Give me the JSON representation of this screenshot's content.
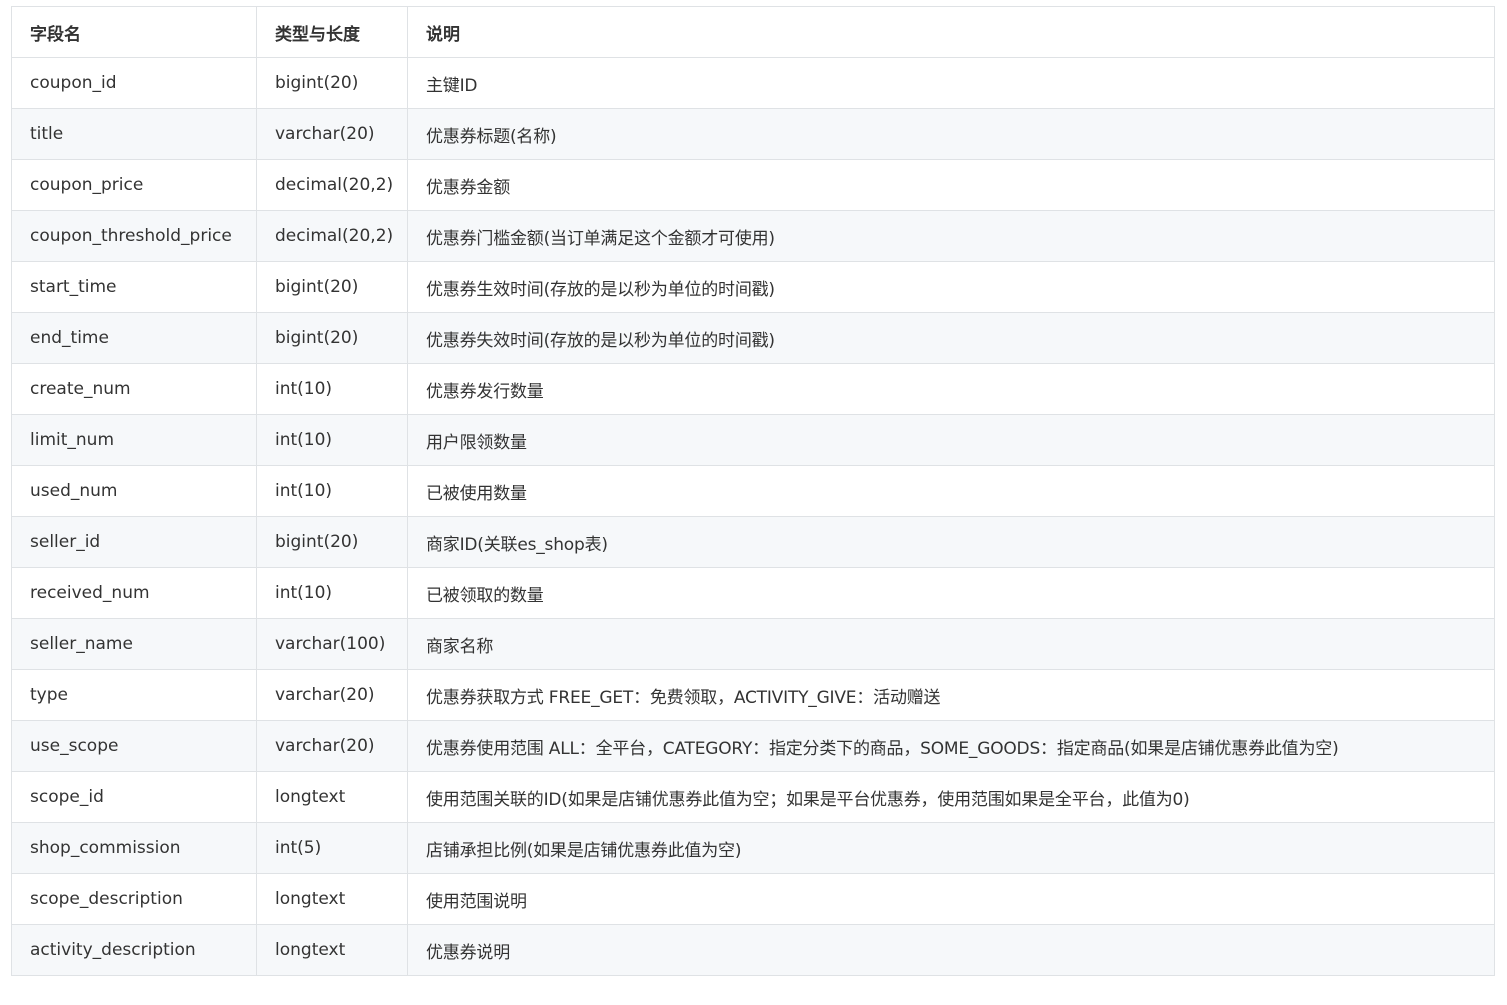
{
  "table": {
    "headers": [
      "字段名",
      "类型与长度",
      "说明"
    ],
    "rows": [
      [
        "coupon_id",
        "bigint(20)",
        "主键ID"
      ],
      [
        "title",
        "varchar(20)",
        "优惠券标题(名称)"
      ],
      [
        "coupon_price",
        "decimal(20,2)",
        "优惠券金额"
      ],
      [
        "coupon_threshold_price",
        "decimal(20,2)",
        "优惠券门槛金额(当订单满足这个金额才可使用)"
      ],
      [
        "start_time",
        "bigint(20)",
        "优惠券生效时间(存放的是以秒为单位的时间戳)"
      ],
      [
        "end_time",
        "bigint(20)",
        "优惠券失效时间(存放的是以秒为单位的时间戳)"
      ],
      [
        "create_num",
        "int(10)",
        "优惠券发行数量"
      ],
      [
        "limit_num",
        "int(10)",
        "用户限领数量"
      ],
      [
        "used_num",
        "int(10)",
        "已被使用数量"
      ],
      [
        "seller_id",
        "bigint(20)",
        "商家ID(关联es_shop表)"
      ],
      [
        "received_num",
        "int(10)",
        "已被领取的数量"
      ],
      [
        "seller_name",
        "varchar(100)",
        "商家名称"
      ],
      [
        "type",
        "varchar(20)",
        "优惠券获取方式 FREE_GET：免费领取，ACTIVITY_GIVE：活动赠送"
      ],
      [
        "use_scope",
        "varchar(20)",
        "优惠券使用范围 ALL：全平台，CATEGORY：指定分类下的商品，SOME_GOODS：指定商品(如果是店铺优惠券此值为空)"
      ],
      [
        "scope_id",
        "longtext",
        "使用范围关联的ID(如果是店铺优惠券此值为空；如果是平台优惠券，使用范围如果是全平台，此值为0)"
      ],
      [
        "shop_commission",
        "int(5)",
        "店铺承担比例(如果是店铺优惠券此值为空)"
      ],
      [
        "scope_description",
        "longtext",
        "使用范围说明"
      ],
      [
        "activity_description",
        "longtext",
        "优惠券说明"
      ]
    ]
  }
}
